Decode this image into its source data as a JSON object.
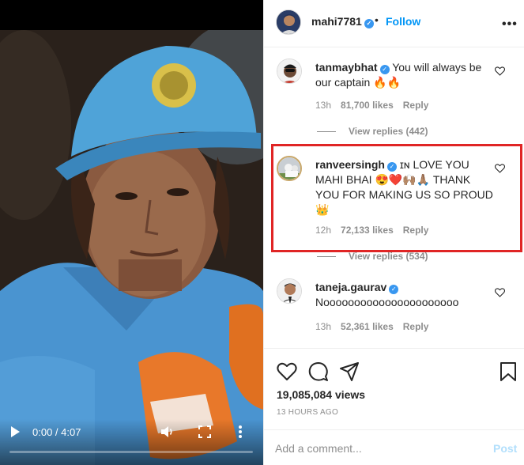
{
  "video": {
    "time": "0:00 / 4:07",
    "progress_fraction": 0.0,
    "icons": {
      "play": "play-icon",
      "volume": "volume-icon",
      "fullscreen": "fullscreen-icon",
      "more": "vertical-dots-icon"
    }
  },
  "header": {
    "username": "mahi7781",
    "separator": "•",
    "follow_label": "Follow",
    "options": "•••"
  },
  "comments": [
    {
      "username": "tanmaybhat",
      "text": " You will always be our captain 🔥🔥",
      "time": "13h",
      "likes": "81,700 likes",
      "reply": "Reply",
      "view_replies": "View replies (442)"
    },
    {
      "username": "ranveersingh",
      "text": " ɪɴ LOVE YOU MAHI BHAI 😍❤️🙌🏽🙏🏽 THANK YOU FOR MAKING US SO PROUD 👑",
      "time": "12h",
      "likes": "72,133 likes",
      "reply": "Reply",
      "view_replies": "View replies (534)"
    },
    {
      "username": "taneja.gaurav",
      "text": " Noooooooooooooooooooooo",
      "time": "13h",
      "likes": "52,361 likes",
      "reply": "Reply"
    }
  ],
  "actions": {
    "views": "19,085,084 views",
    "timestamp": "13 HOURS AGO"
  },
  "comment_box": {
    "placeholder": "Add a comment...",
    "post_label": "Post"
  },
  "colors": {
    "accent": "#0095f6",
    "verified": "#3897f0",
    "highlight": "#e02525",
    "muted": "#8e8e8e"
  }
}
